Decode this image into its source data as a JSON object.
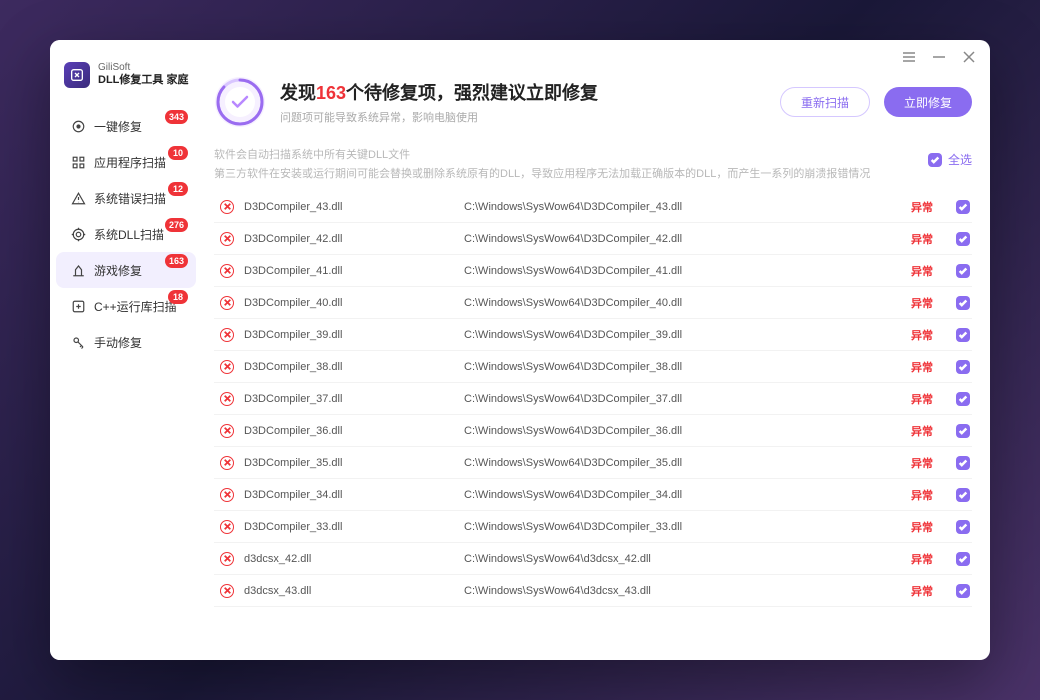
{
  "brand": {
    "sub": "GiliSoft",
    "title": "DLL修复工具 家庭"
  },
  "window_controls": {
    "menu": "≡",
    "min": "—",
    "close": "✕"
  },
  "sidebar_items": [
    {
      "label": "一键修复",
      "badge": "343"
    },
    {
      "label": "应用程序扫描",
      "badge": "10"
    },
    {
      "label": "系统错误扫描",
      "badge": "12"
    },
    {
      "label": "系统DLL扫描",
      "badge": "276"
    },
    {
      "label": "游戏修复",
      "badge": "163"
    },
    {
      "label": "C++运行库扫描",
      "badge": "18"
    },
    {
      "label": "手动修复",
      "badge": ""
    }
  ],
  "header": {
    "title_prefix": "发现",
    "count": "163",
    "title_suffix": "个待修复项，强烈建议立即修复",
    "subtitle": "问题项可能导致系统异常，影响电脑使用",
    "rescan": "重新扫描",
    "repair": "立即修复"
  },
  "info": {
    "line1": "软件会自动扫描系统中所有关键DLL文件",
    "line2": "第三方软件在安装或运行期间可能会替换或删除系统原有的DLL，导致应用程序无法加载正确版本的DLL，而产生一系列的崩溃报错情况",
    "select_all": "全选"
  },
  "status_label": "异常",
  "dlls": [
    {
      "name": "D3DCompiler_43.dll",
      "path": "C:\\Windows\\SysWow64\\D3DCompiler_43.dll"
    },
    {
      "name": "D3DCompiler_42.dll",
      "path": "C:\\Windows\\SysWow64\\D3DCompiler_42.dll"
    },
    {
      "name": "D3DCompiler_41.dll",
      "path": "C:\\Windows\\SysWow64\\D3DCompiler_41.dll"
    },
    {
      "name": "D3DCompiler_40.dll",
      "path": "C:\\Windows\\SysWow64\\D3DCompiler_40.dll"
    },
    {
      "name": "D3DCompiler_39.dll",
      "path": "C:\\Windows\\SysWow64\\D3DCompiler_39.dll"
    },
    {
      "name": "D3DCompiler_38.dll",
      "path": "C:\\Windows\\SysWow64\\D3DCompiler_38.dll"
    },
    {
      "name": "D3DCompiler_37.dll",
      "path": "C:\\Windows\\SysWow64\\D3DCompiler_37.dll"
    },
    {
      "name": "D3DCompiler_36.dll",
      "path": "C:\\Windows\\SysWow64\\D3DCompiler_36.dll"
    },
    {
      "name": "D3DCompiler_35.dll",
      "path": "C:\\Windows\\SysWow64\\D3DCompiler_35.dll"
    },
    {
      "name": "D3DCompiler_34.dll",
      "path": "C:\\Windows\\SysWow64\\D3DCompiler_34.dll"
    },
    {
      "name": "D3DCompiler_33.dll",
      "path": "C:\\Windows\\SysWow64\\D3DCompiler_33.dll"
    },
    {
      "name": "d3dcsx_42.dll",
      "path": "C:\\Windows\\SysWow64\\d3dcsx_42.dll"
    },
    {
      "name": "d3dcsx_43.dll",
      "path": "C:\\Windows\\SysWow64\\d3dcsx_43.dll"
    }
  ]
}
